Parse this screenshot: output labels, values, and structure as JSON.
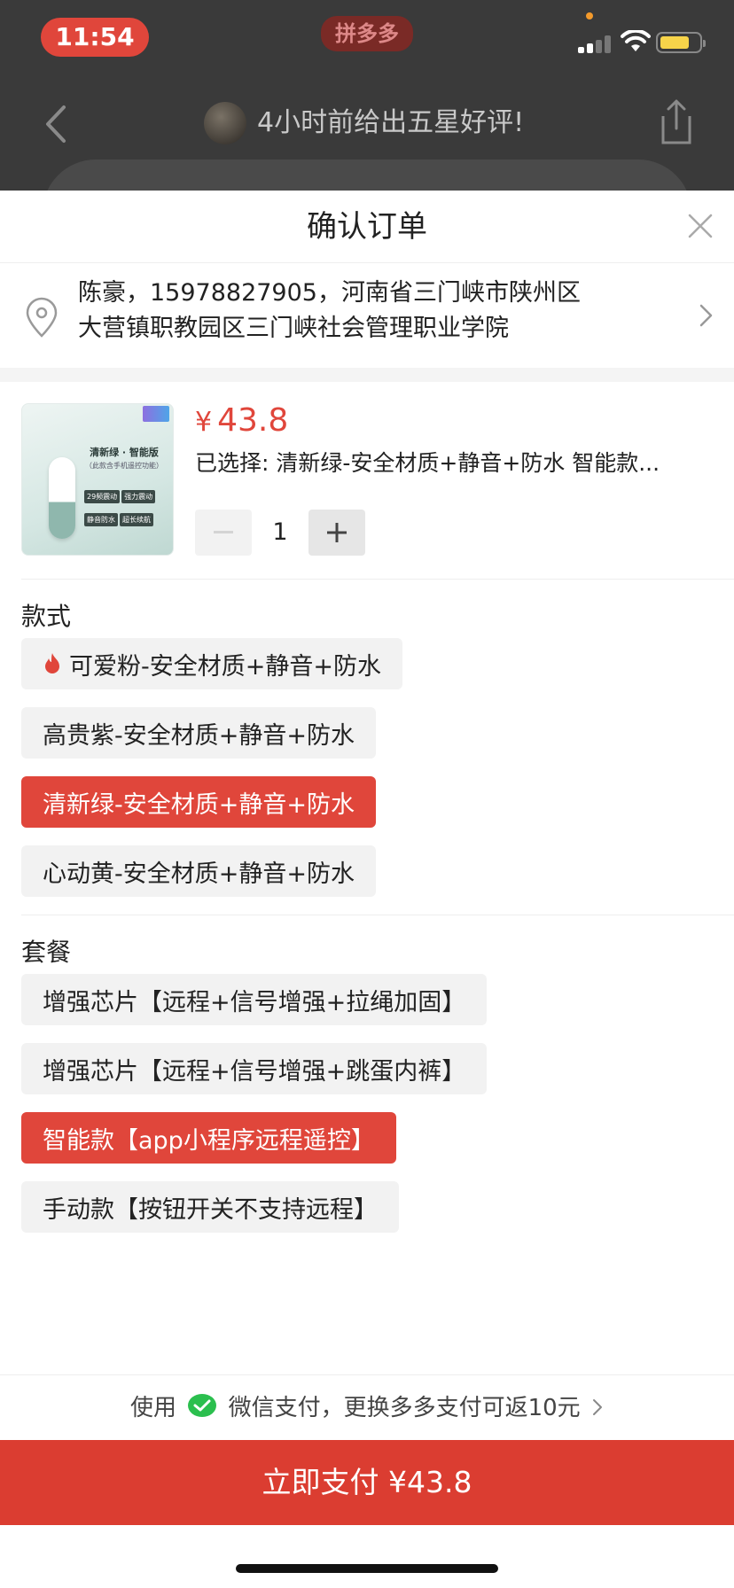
{
  "status_bar": {
    "time": "11:54",
    "app_badge": "拼多多"
  },
  "nav": {
    "title": "4小时前给出五星好评!"
  },
  "sheet": {
    "title": "确认订单"
  },
  "address": {
    "line1": "陈豪，15978827905，河南省三门峡市陕州区",
    "line2": "大营镇职教园区三门峡社会管理职业学院"
  },
  "product": {
    "currency": "¥",
    "price": "43.8",
    "selected": "已选择: 清新绿-安全材质+静音+防水 智能款...",
    "quantity": "1",
    "thumb_title": "清新绿 · 智能版",
    "thumb_sub": "（此款含手机遥控功能）",
    "thumb_tags": [
      "29频震动",
      "强力震动",
      "静音防水",
      "超长续航"
    ]
  },
  "style_group": {
    "title": "款式",
    "options": [
      {
        "label": "可爱粉-安全材质+静音+防水",
        "selected": false,
        "hot": true
      },
      {
        "label": "高贵紫-安全材质+静音+防水",
        "selected": false,
        "hot": false
      },
      {
        "label": "清新绿-安全材质+静音+防水",
        "selected": true,
        "hot": false
      },
      {
        "label": "心动黄-安全材质+静音+防水",
        "selected": false,
        "hot": false
      }
    ]
  },
  "package_group": {
    "title": "套餐",
    "options": [
      {
        "label": "增强芯片【远程+信号增强+拉绳加固】",
        "selected": false
      },
      {
        "label": "增强芯片【远程+信号增强+跳蛋内裤】",
        "selected": false
      },
      {
        "label": "智能款【app小程序远程遥控】",
        "selected": true
      },
      {
        "label": "手动款【按钮开关不支持远程】",
        "selected": false
      }
    ]
  },
  "footer": {
    "tip_prefix": "使用",
    "tip_text": "微信支付，更换多多支付可返10元",
    "pay_label": "立即支付 ¥43.8"
  },
  "colors": {
    "accent": "#e0463b",
    "pay_button": "#db3d31",
    "wechat": "#2bbf4e"
  },
  "icons": [
    "back-icon",
    "share-icon",
    "close-icon",
    "location-pin-icon",
    "chevron-right-icon",
    "fire-icon",
    "minus-icon",
    "plus-icon",
    "wechat-icon"
  ]
}
